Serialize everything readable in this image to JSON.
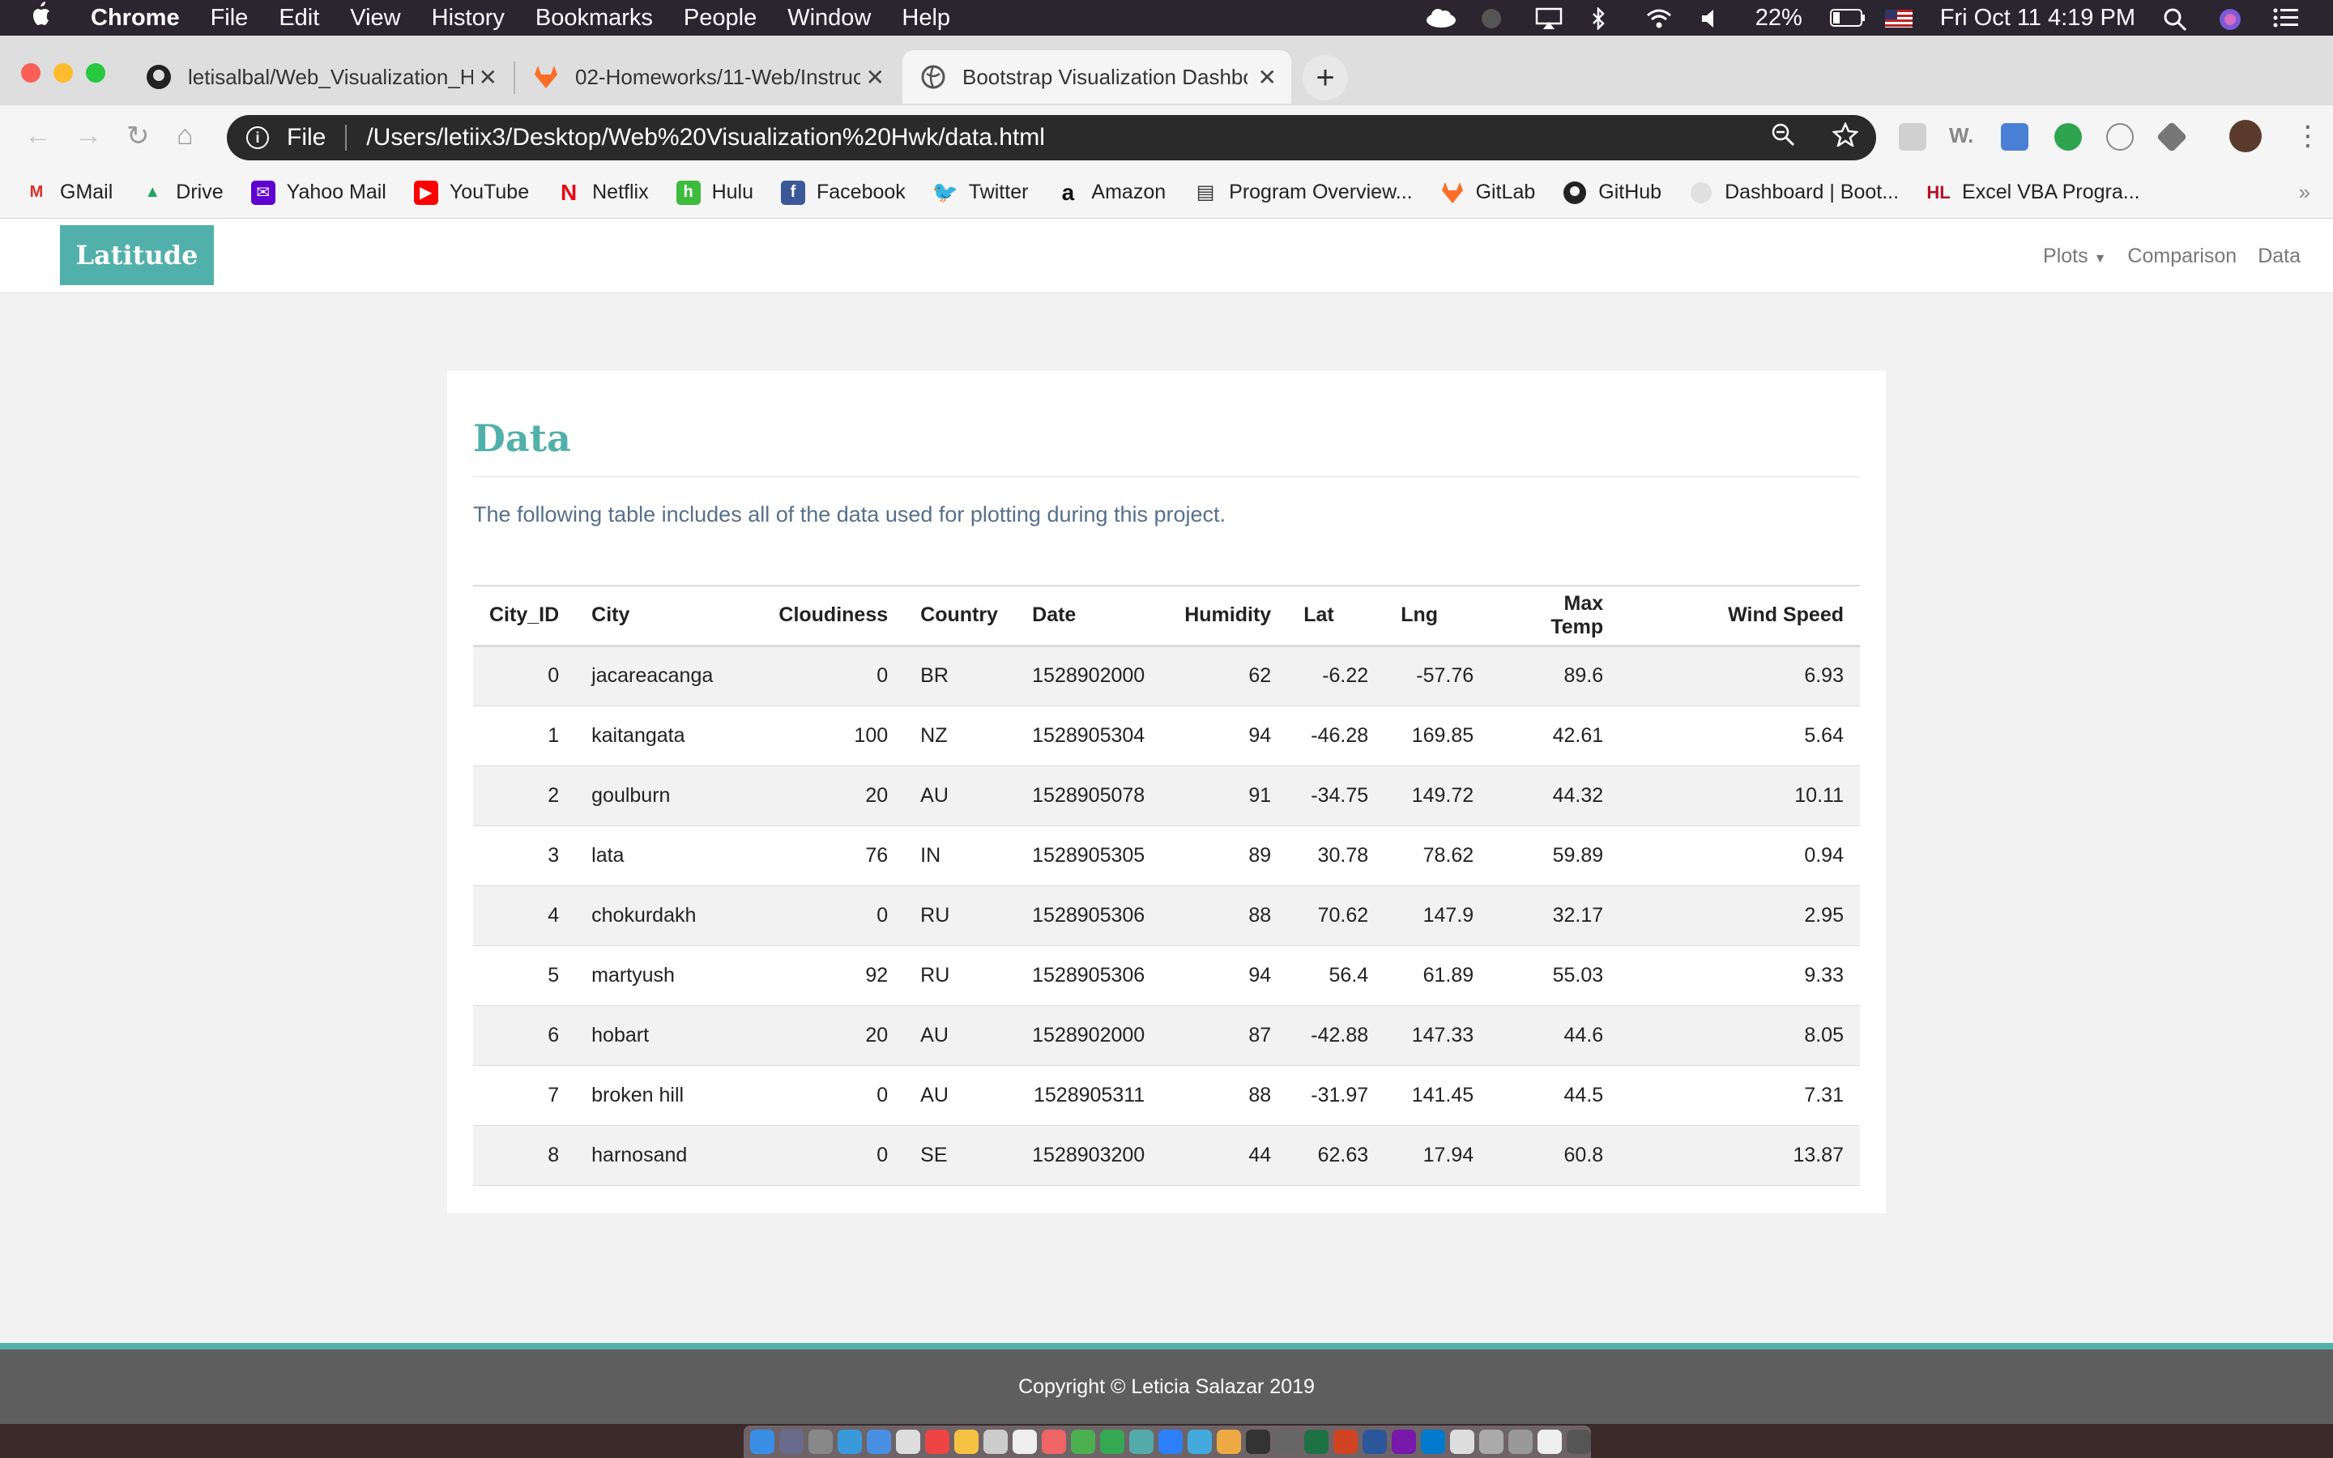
{
  "menubar": {
    "app": "Chrome",
    "items": [
      "File",
      "Edit",
      "View",
      "History",
      "Bookmarks",
      "People",
      "Window",
      "Help"
    ],
    "battery": "22%",
    "clock": "Fri Oct 11  4:19 PM"
  },
  "tabs": [
    {
      "title": "letisalbal/Web_Visualization_Hw",
      "favicon": "github-icon"
    },
    {
      "title": "02-Homeworks/11-Web/Instruc",
      "favicon": "gitlab-icon"
    },
    {
      "title": "Bootstrap Visualization Dashbo",
      "favicon": "globe-icon"
    }
  ],
  "address": {
    "scheme": "File",
    "url": "/Users/letiix3/Desktop/Web%20Visualization%20Hwk/data.html"
  },
  "bookmarks": [
    {
      "label": "GMail",
      "icon": "gmail-icon",
      "color": "#d93025",
      "glyph": "M"
    },
    {
      "label": "Drive",
      "icon": "drive-icon",
      "color": "#1fa463",
      "glyph": "▲"
    },
    {
      "label": "Yahoo Mail",
      "icon": "yahoo-mail-icon",
      "color": "#6001d2",
      "glyph": "✉"
    },
    {
      "label": "YouTube",
      "icon": "youtube-icon",
      "color": "#ff0000",
      "glyph": "▶"
    },
    {
      "label": "Netflix",
      "icon": "netflix-icon",
      "color": "#e50914",
      "glyph": "N"
    },
    {
      "label": "Hulu",
      "icon": "hulu-icon",
      "color": "#3dbb3d",
      "glyph": "h"
    },
    {
      "label": "Facebook",
      "icon": "facebook-icon",
      "color": "#3b5998",
      "glyph": "f"
    },
    {
      "label": "Twitter",
      "icon": "twitter-icon",
      "color": "#1da1f2",
      "glyph": "t"
    },
    {
      "label": "Amazon",
      "icon": "amazon-icon",
      "color": "#ffffff",
      "glyph": "a"
    },
    {
      "label": "Program Overview...",
      "icon": "book-icon",
      "color": "#333333",
      "glyph": "▤"
    },
    {
      "label": "GitLab",
      "icon": "gitlab-icon",
      "color": "#fc6d26",
      "glyph": "◆"
    },
    {
      "label": "GitHub",
      "icon": "github-icon",
      "color": "#222222",
      "glyph": "●"
    },
    {
      "label": "Dashboard | Boot...",
      "icon": "globe-icon",
      "color": "#cccccc",
      "glyph": "◌"
    },
    {
      "label": "Excel VBA Progra...",
      "icon": "hl-icon",
      "color": "#ffffff",
      "glyph": "HL"
    }
  ],
  "navbar": {
    "brand": "Latitude",
    "links": [
      "Plots",
      "Comparison",
      "Data"
    ]
  },
  "page": {
    "title": "Data",
    "description": "The following table includes all of the data used for plotting during this project.",
    "columns": [
      "City_ID",
      "City",
      "Cloudiness",
      "Country",
      "Date",
      "Humidity",
      "Lat",
      "Lng",
      "Max Temp",
      "Wind Speed"
    ],
    "rows": [
      [
        "0",
        "jacareacanga",
        "0",
        "BR",
        "1528902000",
        "62",
        "-6.22",
        "-57.76",
        "89.6",
        "6.93"
      ],
      [
        "1",
        "kaitangata",
        "100",
        "NZ",
        "1528905304",
        "94",
        "-46.28",
        "169.85",
        "42.61",
        "5.64"
      ],
      [
        "2",
        "goulburn",
        "20",
        "AU",
        "1528905078",
        "91",
        "-34.75",
        "149.72",
        "44.32",
        "10.11"
      ],
      [
        "3",
        "lata",
        "76",
        "IN",
        "1528905305",
        "89",
        "30.78",
        "78.62",
        "59.89",
        "0.94"
      ],
      [
        "4",
        "chokurdakh",
        "0",
        "RU",
        "1528905306",
        "88",
        "70.62",
        "147.9",
        "32.17",
        "2.95"
      ],
      [
        "5",
        "martyush",
        "92",
        "RU",
        "1528905306",
        "94",
        "56.4",
        "61.89",
        "55.03",
        "9.33"
      ],
      [
        "6",
        "hobart",
        "20",
        "AU",
        "1528902000",
        "87",
        "-42.88",
        "147.33",
        "44.6",
        "8.05"
      ],
      [
        "7",
        "broken hill",
        "0",
        "AU",
        "1528905311",
        "88",
        "-31.97",
        "141.45",
        "44.5",
        "7.31"
      ],
      [
        "8",
        "harnosand",
        "0",
        "SE",
        "1528903200",
        "44",
        "62.63",
        "17.94",
        "60.8",
        "13.87"
      ]
    ]
  },
  "footer": {
    "text": "Copyright © Leticia Salazar 2019"
  },
  "colors": {
    "accent": "#52b0aa",
    "footer": "#5e5e5e"
  }
}
